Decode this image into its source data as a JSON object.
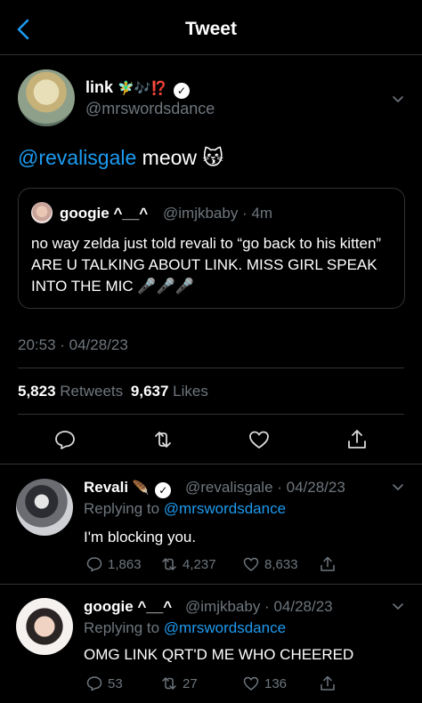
{
  "header": {
    "title": "Tweet"
  },
  "tweet": {
    "author_name": "link",
    "author_emoji": "🧚‍♂️🎶⁉️",
    "verified_mark": "✓",
    "handle": "@mrswordsdance",
    "mention": "@revalisgale",
    "text": " meow 😽",
    "quote": {
      "author": "googie ^__^",
      "handle": "@imjkbaby · 4m",
      "text": "no way zelda just told revali to “go back to his kitten” ARE U TALKING ABOUT LINK. MISS GIRL SPEAK INTO THE MIC 🎤🎤🎤"
    },
    "timestamp": "20:53 · 04/28/23",
    "retweets_count": "5,823",
    "retweets_label": "Retweets",
    "likes_count": "9,637",
    "likes_label": "Likes"
  },
  "replies": [
    {
      "name": "Revali",
      "name_emoji": "🪶",
      "handle": "@revalisgale · 04/28/23",
      "replying_prefix": "Replying to",
      "replying_to": "@mrswordsdance",
      "text": "I'm blocking you.",
      "reply_count": "1,863",
      "retweet_count": "4,237",
      "like_count": "8,633"
    },
    {
      "name": "googie ^__^",
      "name_emoji": "",
      "handle": "@imjkbaby · 04/28/23",
      "replying_prefix": "Replying to",
      "replying_to": "@mrswordsdance",
      "text": "OMG LINK QRT'D ME WHO CHEERED",
      "reply_count": "53",
      "retweet_count": "27",
      "like_count": "136"
    }
  ],
  "colors": {
    "accent": "#1d9bf0",
    "muted": "#6e767d",
    "background": "#000000",
    "divider": "#2f3336"
  },
  "icons": [
    "back-arrow-icon",
    "chevron-down-icon",
    "verified-icon",
    "reply-icon",
    "retweet-icon",
    "like-icon",
    "share-icon"
  ]
}
